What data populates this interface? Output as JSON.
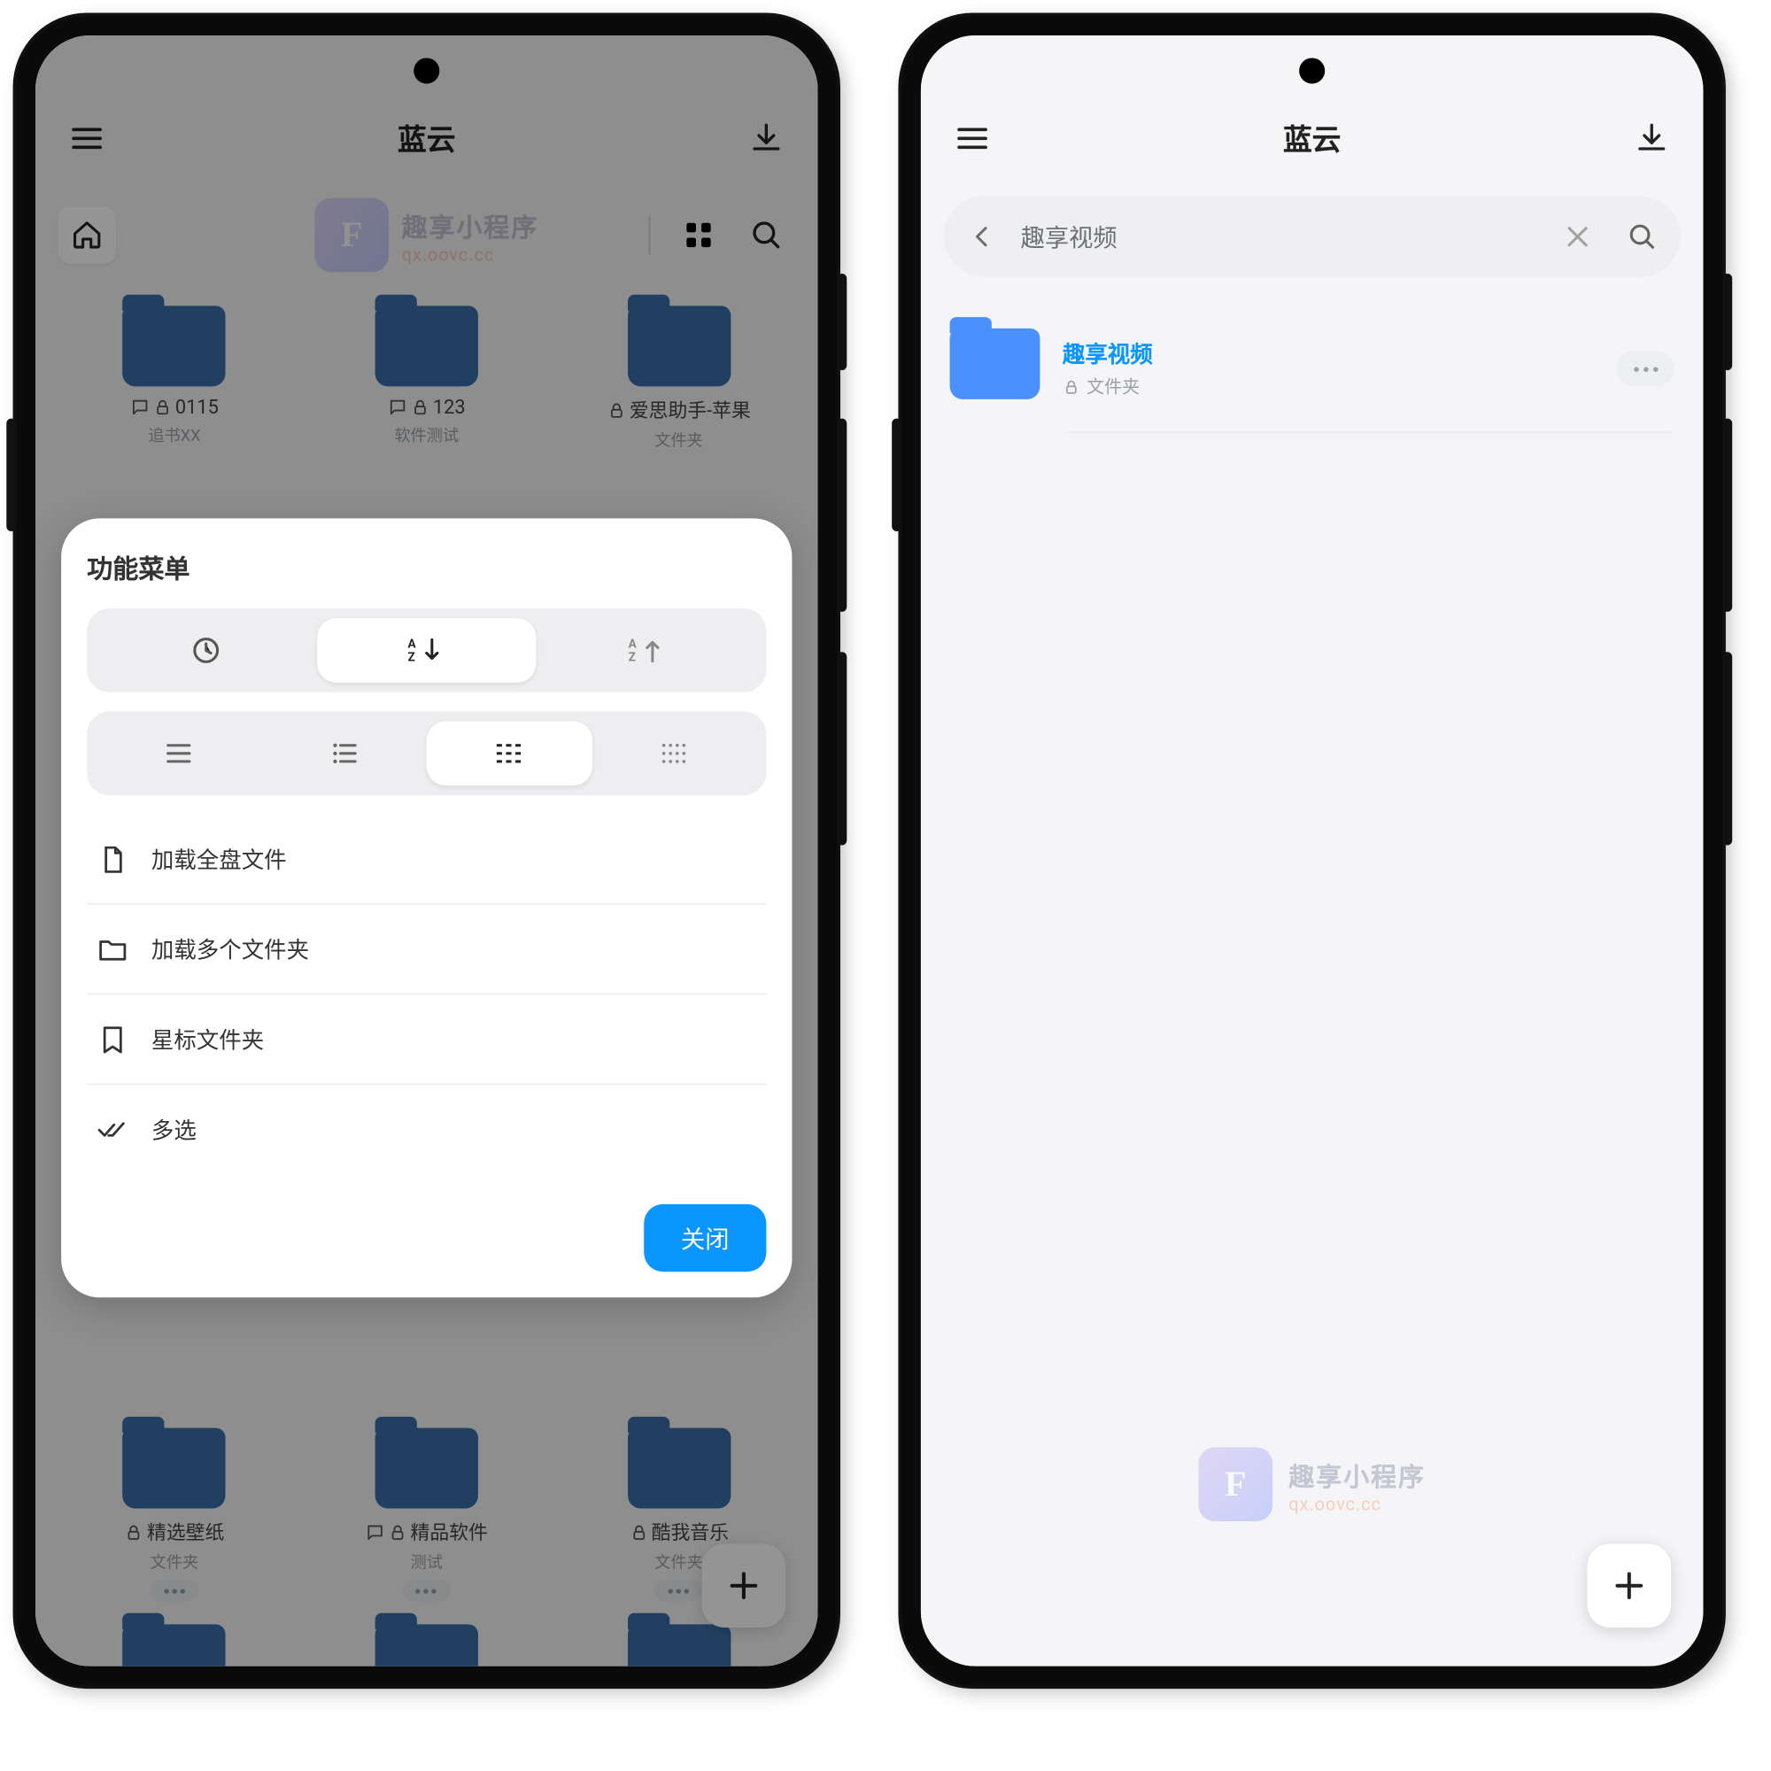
{
  "left": {
    "title": "蓝云",
    "watermark": {
      "brand": "趣享小程序",
      "url": "qx.oovc.cc",
      "logoLetter": "F"
    },
    "grid": {
      "row1": [
        {
          "name": "0115",
          "sub": "追书XX"
        },
        {
          "name": "123",
          "sub": "软件测试"
        },
        {
          "name": "爱思助手-苹果",
          "sub": "文件夹"
        }
      ],
      "row2": [
        {
          "name": "精选壁纸",
          "sub": "文件夹"
        },
        {
          "name": "精品软件",
          "sub": "测试"
        },
        {
          "name": "酷我音乐",
          "sub": "文件夹"
        }
      ]
    },
    "sheet": {
      "title": "功能菜单",
      "items": [
        "加载全盘文件",
        "加载多个文件夹",
        "星标文件夹",
        "多选"
      ],
      "close": "关闭"
    }
  },
  "right": {
    "title": "蓝云",
    "searchQuery": "趣享视频",
    "result": {
      "name": "趣享视频",
      "type": "文件夹"
    },
    "watermark": {
      "brand": "趣享小程序",
      "url": "qx.oovc.cc",
      "logoLetter": "F"
    }
  }
}
